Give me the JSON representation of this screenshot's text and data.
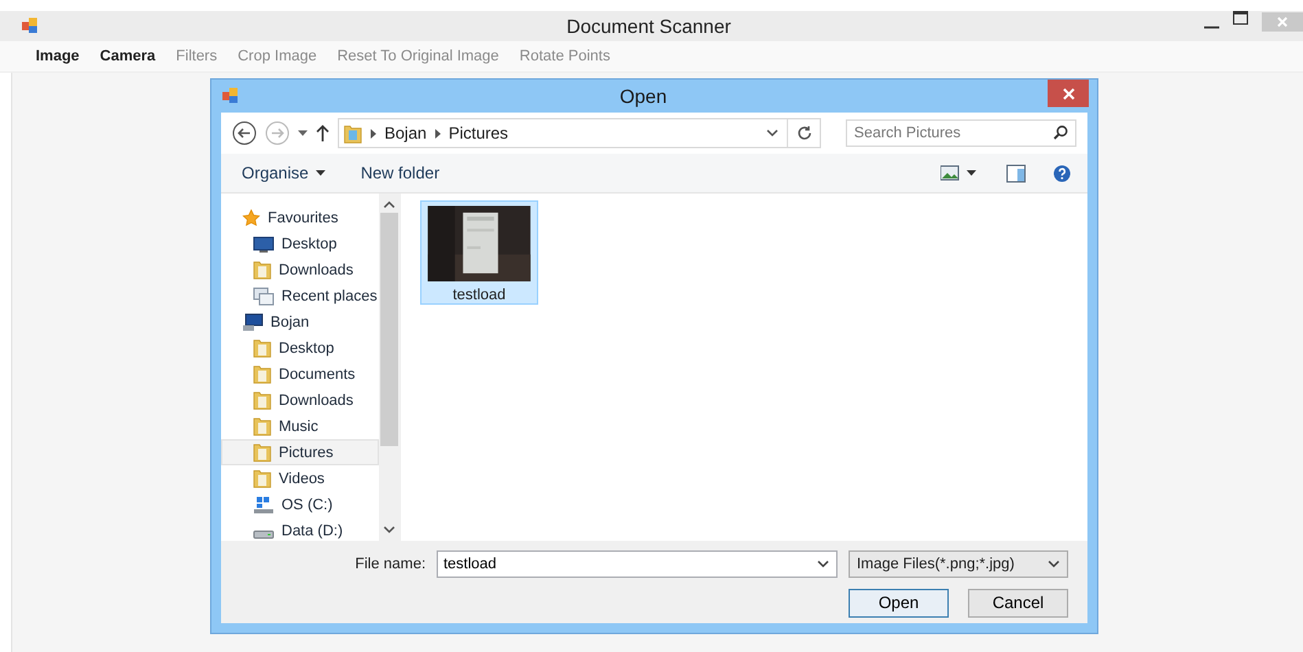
{
  "window": {
    "title": "Document Scanner"
  },
  "menu": [
    {
      "label": "Image",
      "disabled": false
    },
    {
      "label": "Camera",
      "disabled": false
    },
    {
      "label": "Filters",
      "disabled": true
    },
    {
      "label": "Crop Image",
      "disabled": true
    },
    {
      "label": "Reset To Original Image",
      "disabled": true
    },
    {
      "label": "Rotate Points",
      "disabled": true
    }
  ],
  "dialog": {
    "title": "Open",
    "address": {
      "path": [
        "Bojan",
        "Pictures"
      ]
    },
    "search": {
      "placeholder": "Search Pictures"
    },
    "toolbar": [
      {
        "label": "Organise",
        "dropdown": true
      },
      {
        "label": "New folder",
        "dropdown": false
      }
    ],
    "nav": [
      {
        "label": "Favourites",
        "kind": "star",
        "selected": false,
        "children": [
          {
            "label": "Desktop",
            "kind": "monitor",
            "selected": false
          },
          {
            "label": "Downloads",
            "kind": "folder",
            "selected": false
          },
          {
            "label": "Recent places",
            "kind": "recent",
            "selected": false
          }
        ]
      },
      {
        "label": "Bojan",
        "kind": "computer",
        "selected": false,
        "children": [
          {
            "label": "Desktop",
            "kind": "folder",
            "selected": false
          },
          {
            "label": "Documents",
            "kind": "folder",
            "selected": false
          },
          {
            "label": "Downloads",
            "kind": "folder",
            "selected": false
          },
          {
            "label": "Music",
            "kind": "folder",
            "selected": false
          },
          {
            "label": "Pictures",
            "kind": "folder",
            "selected": true
          },
          {
            "label": "Videos",
            "kind": "folder",
            "selected": false
          },
          {
            "label": "OS (C:)",
            "kind": "drive",
            "selected": false
          },
          {
            "label": "Data (D:)",
            "kind": "disk",
            "selected": false
          }
        ]
      }
    ],
    "files": [
      {
        "name": "testload",
        "kind": "picture",
        "selected": true
      }
    ],
    "file_name": {
      "label": "File name:",
      "value": "testload"
    },
    "file_type": {
      "value": "Image Files(*.png;*.jpg)"
    },
    "buttons": [
      {
        "label": "Open",
        "default": true
      },
      {
        "label": "Cancel",
        "default": false
      }
    ]
  }
}
